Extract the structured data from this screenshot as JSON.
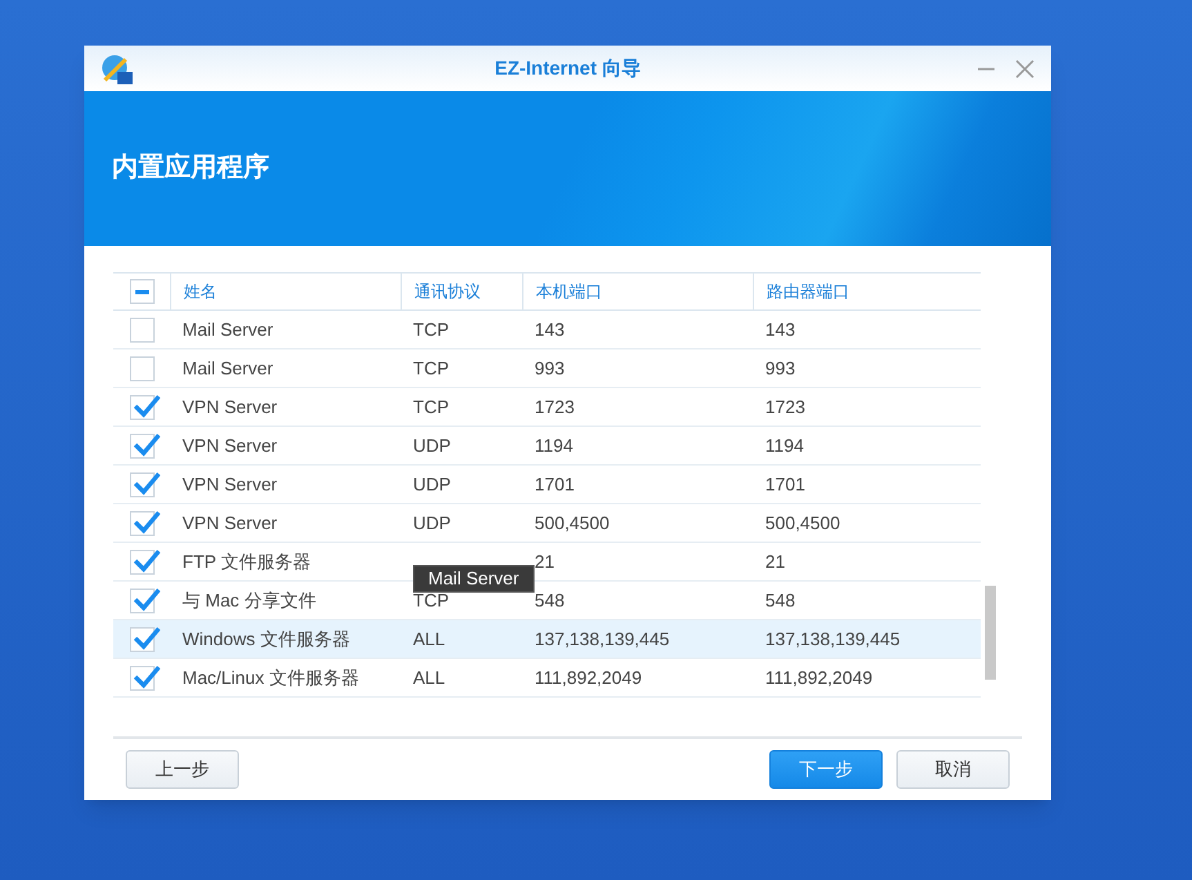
{
  "window": {
    "title": "EZ-Internet 向导"
  },
  "banner": {
    "title": "内置应用程序"
  },
  "table": {
    "select_all": {
      "indeterminate": true
    },
    "columns": [
      "姓名",
      "通讯协议",
      "本机端口",
      "路由器端口"
    ],
    "rows": [
      {
        "checked": false,
        "selected": false,
        "cells": [
          "Mail Server",
          "TCP",
          "143",
          "143"
        ]
      },
      {
        "checked": false,
        "selected": false,
        "cells": [
          "Mail Server",
          "TCP",
          "993",
          "993"
        ]
      },
      {
        "checked": true,
        "selected": false,
        "cells": [
          "VPN Server",
          "TCP",
          "1723",
          "1723"
        ]
      },
      {
        "checked": true,
        "selected": false,
        "cells": [
          "VPN Server",
          "UDP",
          "1194",
          "1194"
        ]
      },
      {
        "checked": true,
        "selected": false,
        "cells": [
          "VPN Server",
          "UDP",
          "1701",
          "1701"
        ]
      },
      {
        "checked": true,
        "selected": false,
        "cells": [
          "VPN Server",
          "UDP",
          "500,4500",
          "500,4500"
        ]
      },
      {
        "checked": true,
        "selected": false,
        "cells": [
          "FTP 文件服务器",
          null,
          "21",
          "21"
        ]
      },
      {
        "checked": true,
        "selected": false,
        "cells": [
          "与 Mac 分享文件",
          "TCP",
          "548",
          "548"
        ]
      },
      {
        "checked": true,
        "selected": true,
        "cells": [
          "Windows 文件服务器",
          "ALL",
          "137,138,139,445",
          "137,138,139,445"
        ]
      },
      {
        "checked": true,
        "selected": false,
        "cells": [
          "Mac/Linux 文件服务器",
          "ALL",
          "111,892,2049",
          "111,892,2049"
        ]
      }
    ]
  },
  "tooltip": {
    "text": "Mail Server"
  },
  "buttons": [
    {
      "label": "上一步",
      "kind": "secondary"
    },
    {
      "label": "下一步",
      "kind": "primary"
    },
    {
      "label": "取消",
      "kind": "secondary"
    }
  ]
}
